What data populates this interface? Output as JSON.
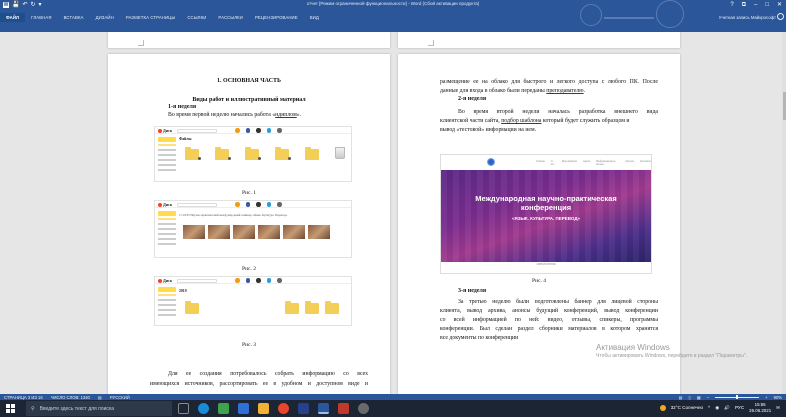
{
  "window": {
    "title": "отчет [Режим ограниченной функциональности] - Word (Сбой активации продукта)",
    "controls": [
      "?",
      "⧉",
      "–",
      "□",
      "✕"
    ]
  },
  "ribbon": {
    "tabs": [
      "ФАЙЛ",
      "ГЛАВНАЯ",
      "ВСТАВКА",
      "ДИЗАЙН",
      "РАЗМЕТКА СТРАНИЦЫ",
      "ССЫЛКИ",
      "РАССЫЛКИ",
      "РЕЦЕНЗИРОВАНИЕ",
      "ВИД"
    ],
    "account": "Учетная запись Майкрософт"
  },
  "left_page": {
    "heading": "1. ОСНОВНАЯ ЧАСТЬ",
    "subheading": "Виды работ и иллюстративный материал",
    "week1_title": "1-я неделя",
    "week1_text_before": "Во время первой неделю начались работа «",
    "week1_link": "ндиплом",
    "week1_text_after": "».",
    "fig1": "Рис. 1",
    "fig2": "Рис. 2",
    "fig3": "Рис. 3",
    "fig2_heading": "17-18.05 Научно-практический международный семинар «Язык. Культура. Перевод»",
    "bottom_line1": "Для ее создания потребовалось собрать информацию со всех",
    "bottom_line2": "имеющихся источников, рассортировать ее в удобном и доступном виде и",
    "shot1_heading": "Файлы",
    "shot3_heading": "2019",
    "shot_logo": "Диск",
    "colors": {
      "upload": "#ffdb4d",
      "folder": "#f4cf57"
    }
  },
  "right_page": {
    "top_text_1": "размещение ее на облако для быстрого и легкого доступа с любого ПК. После",
    "top_text_2_before": "данные для входа в облако были переданы ",
    "top_text_2_link": "преподавателю",
    "top_text_2_after": ".",
    "week2_title": "2-я неделя",
    "week2_line1": "Во время второй недели началась разработка внешнего вида",
    "week2_line2_before": "клиентской части сайта, ",
    "week2_line2_link": "подбор шаблона",
    "week2_line2_after": " который будет служить образцом и",
    "week2_line3": "вывод «тестовой» информации на нем.",
    "fig4": "Рис. 4",
    "conf_title_1": "Международная научно-практическая",
    "conf_title_2": "конференция",
    "conf_subtitle": "«ЯЗЫК. КУЛЬТУРА. ПЕРЕВОД»",
    "conf_nav": [
      "Главная",
      "О нас",
      "Мероприятия",
      "Архив",
      "Информационное письмо",
      "Оргком.",
      "Контакты"
    ],
    "conf_footer": "ОБНОВЛЕНИЯ",
    "week3_title": "3-я неделя",
    "week3_lines": [
      "За третью неделю были подготовлены баннер для лицевой стороны",
      "клиента, вывод архива, анонсы будущий конференций, вывод конференции",
      "со всей информацией по ней: видео, отзывы, спикеры, программы",
      "конференции. Был сделан раздел сборники материалов в котором хранятся",
      "все документы по конференции"
    ]
  },
  "watermark": {
    "line1": "Активация Windows",
    "line2": "Чтобы активировать Windows, перейдите в раздел \"Параметры\"."
  },
  "statusbar": {
    "page": "СТРАНИЦА 3 ИЗ 16",
    "words": "ЧИСЛО СЛОВ: 1340",
    "lang": "РУССКИЙ",
    "zoom": "90%"
  },
  "taskbar": {
    "search_placeholder": "Введите здесь текст для поиска",
    "weather": "32°C Солнечно",
    "lang": "РУС",
    "time": "15:55",
    "date": "26.06.2021",
    "app_colors": [
      "#8a8a8a",
      "#1a8bd6",
      "#3fa34d",
      "#2f6fd6",
      "#f2b233",
      "#e8452c",
      "#2b579a",
      "#c0392b",
      "#6a6a6a"
    ]
  }
}
